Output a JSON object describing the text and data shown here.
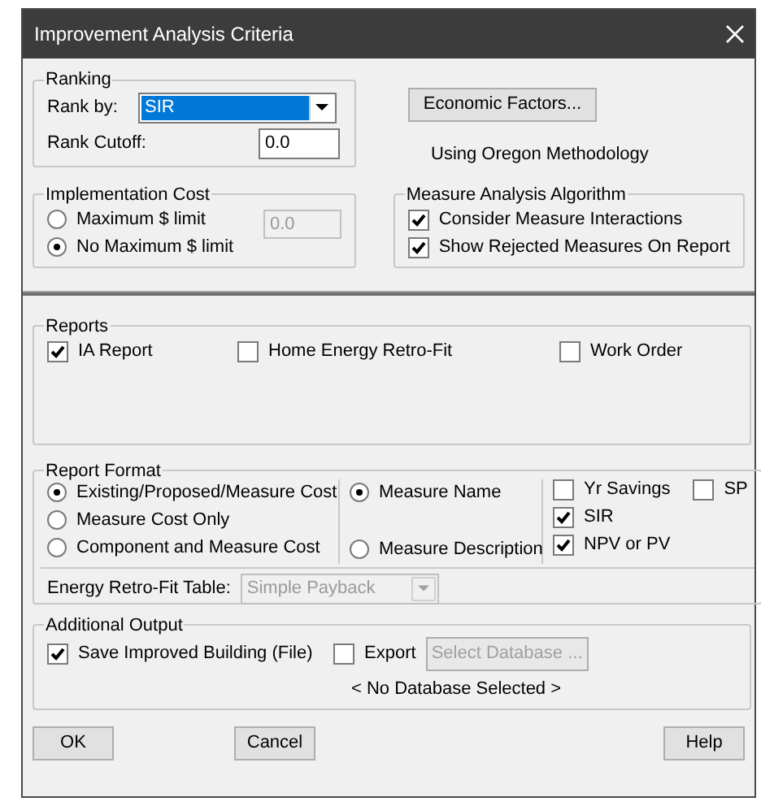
{
  "window": {
    "title": "Improvement Analysis Criteria"
  },
  "ranking": {
    "title": "Ranking",
    "rank_by_label": "Rank by:",
    "rank_by_value": "SIR",
    "rank_cutoff_label": "Rank Cutoff:",
    "rank_cutoff_value": "0.0"
  },
  "economic_factors": {
    "button": "Economic Factors...",
    "note": "Using Oregon Methodology"
  },
  "implementation_cost": {
    "title": "Implementation Cost",
    "limit_value": "0.0",
    "limit_disabled": true,
    "options": [
      {
        "label": "Maximum $ limit",
        "selected": false
      },
      {
        "label": "No Maximum $ limit",
        "selected": true
      }
    ]
  },
  "measure_analysis": {
    "title": "Measure Analysis Algorithm",
    "options": [
      {
        "label": "Consider Measure Interactions",
        "checked": true
      },
      {
        "label": "Show Rejected Measures On Report",
        "checked": true
      }
    ]
  },
  "reports": {
    "title": "Reports",
    "options": [
      {
        "label": "IA Report",
        "checked": true
      },
      {
        "label": "Home Energy Retro-Fit",
        "checked": false
      },
      {
        "label": "Work Order",
        "checked": false
      }
    ]
  },
  "report_format": {
    "title": "Report Format",
    "cost_options": [
      {
        "label": "Existing/Proposed/Measure Cost",
        "selected": true
      },
      {
        "label": "Measure Cost Only",
        "selected": false
      },
      {
        "label": "Component and Measure Cost",
        "selected": false
      }
    ],
    "name_options": [
      {
        "label": "Measure Name",
        "selected": true
      },
      {
        "label": "Measure Description",
        "selected": false
      }
    ],
    "columns": [
      {
        "label": "Yr Savings",
        "checked": false
      },
      {
        "label": "SP",
        "checked": false
      },
      {
        "label": "SIR",
        "checked": true
      },
      {
        "label": "NPV or PV",
        "checked": true
      }
    ],
    "retrofit_table_label": "Energy Retro-Fit Table:",
    "retrofit_table_value": "Simple Payback",
    "retrofit_table_disabled": true
  },
  "additional_output": {
    "title": "Additional Output",
    "save_improved": {
      "label": "Save Improved Building (File)",
      "checked": true
    },
    "export": {
      "label": "Export",
      "checked": false
    },
    "select_database": {
      "label": "Select Database ...",
      "disabled": true
    },
    "database_status": "< No Database Selected >"
  },
  "buttons": [
    "OK",
    "Cancel",
    "Help"
  ]
}
